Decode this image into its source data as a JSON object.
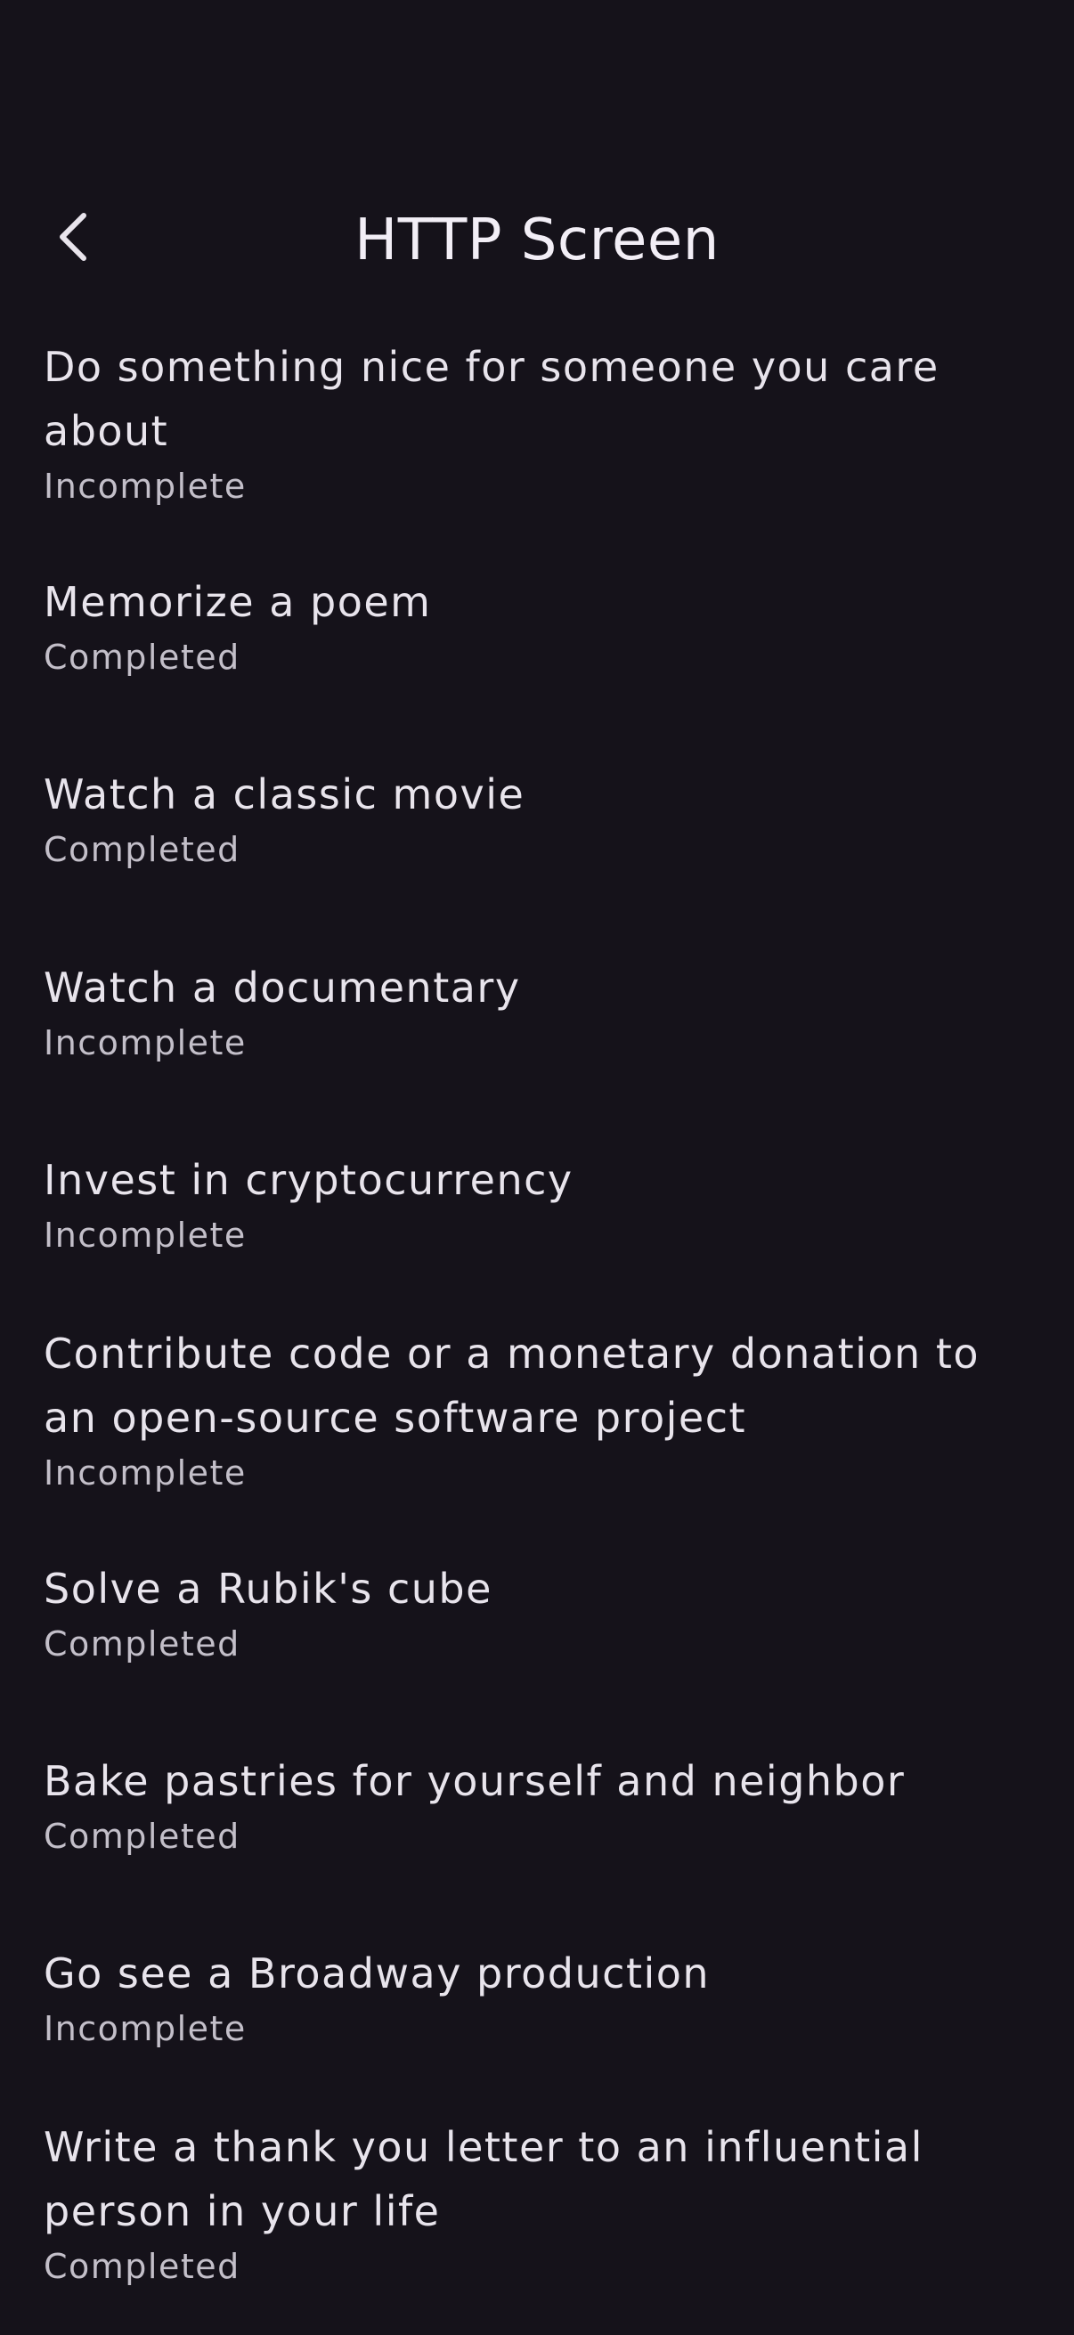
{
  "app_bar": {
    "title": "HTTP Screen",
    "back_icon": "chevron-left-icon"
  },
  "todos": [
    {
      "title": "Do something nice for someone you care about",
      "status": "Incomplete"
    },
    {
      "title": "Memorize a poem",
      "status": "Completed"
    },
    {
      "title": "Watch a classic movie",
      "status": "Completed"
    },
    {
      "title": "Watch a documentary",
      "status": "Incomplete"
    },
    {
      "title": "Invest in cryptocurrency",
      "status": "Incomplete"
    },
    {
      "title": "Contribute code or a monetary donation to an open-source software project",
      "status": "Incomplete"
    },
    {
      "title": "Solve a Rubik's cube",
      "status": "Completed"
    },
    {
      "title": "Bake pastries for yourself and neighbor",
      "status": "Completed"
    },
    {
      "title": "Go see a Broadway production",
      "status": "Incomplete"
    },
    {
      "title": "Write a thank you letter to an influential person in your life",
      "status": "Completed"
    }
  ],
  "colors": {
    "background": "#15121a",
    "title_text": "#e8e4ec",
    "status_text": "#c3bfc9"
  }
}
